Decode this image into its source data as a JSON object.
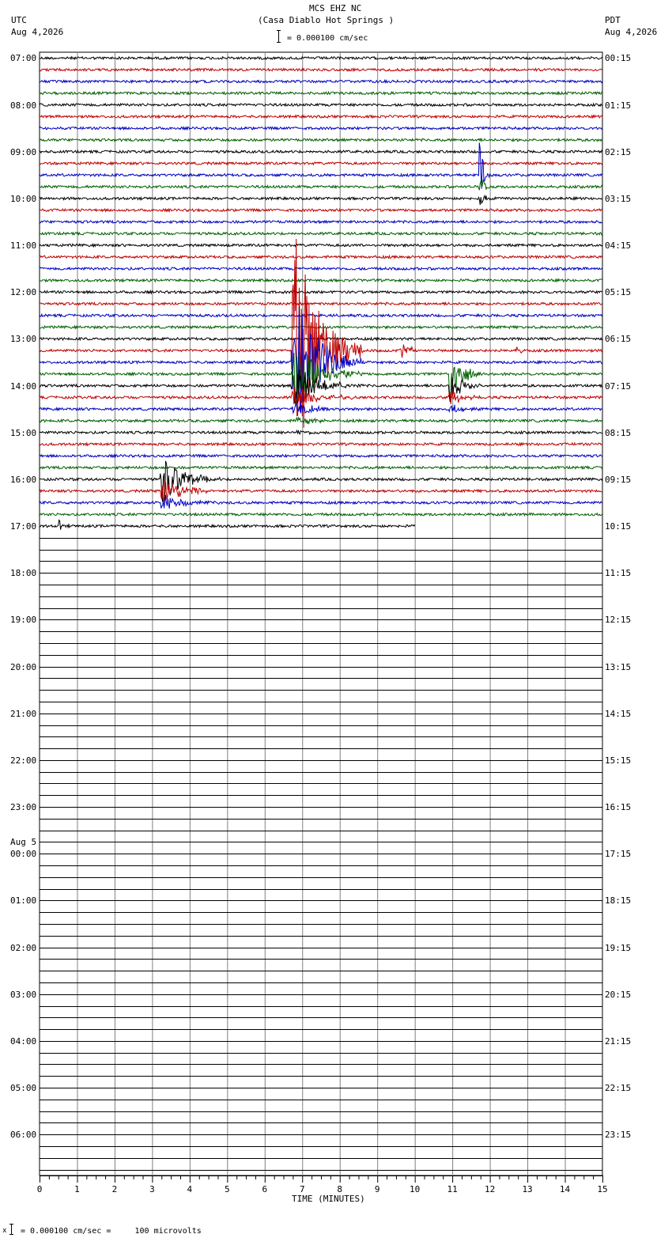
{
  "header": {
    "station": "MCS EHZ NC",
    "location": "(Casa Diablo Hot Springs )",
    "scale_text": "= 0.000100 cm/sec",
    "left_tz": "UTC",
    "left_date": "Aug 4,2026",
    "right_tz": "PDT",
    "right_date": "Aug 4,2026"
  },
  "footer": {
    "scale_text": "= 0.000100 cm/sec =     100 microvolts",
    "mark": "x"
  },
  "chart_data": {
    "type": "line",
    "title": "MCS EHZ NC",
    "subtitle": "(Casa Diablo Hot Springs )",
    "xlabel": "TIME (MINUTES)",
    "xlim": [
      0,
      15
    ],
    "x_ticks": [
      "0",
      "1",
      "2",
      "3",
      "4",
      "5",
      "6",
      "7",
      "8",
      "9",
      "10",
      "11",
      "12",
      "13",
      "14",
      "15"
    ],
    "rows_per_hour": 4,
    "total_rows": 96,
    "trace_colors": [
      "#000000",
      "#c00000",
      "#0000c0",
      "#006000"
    ],
    "grid": true,
    "left_labels": [
      {
        "row": 0,
        "text": "07:00"
      },
      {
        "row": 4,
        "text": "08:00"
      },
      {
        "row": 8,
        "text": "09:00"
      },
      {
        "row": 12,
        "text": "10:00"
      },
      {
        "row": 16,
        "text": "11:00"
      },
      {
        "row": 20,
        "text": "12:00"
      },
      {
        "row": 24,
        "text": "13:00"
      },
      {
        "row": 28,
        "text": "14:00"
      },
      {
        "row": 32,
        "text": "15:00"
      },
      {
        "row": 36,
        "text": "16:00"
      },
      {
        "row": 40,
        "text": "17:00"
      },
      {
        "row": 44,
        "text": "18:00"
      },
      {
        "row": 48,
        "text": "19:00"
      },
      {
        "row": 52,
        "text": "20:00"
      },
      {
        "row": 56,
        "text": "21:00"
      },
      {
        "row": 60,
        "text": "22:00"
      },
      {
        "row": 64,
        "text": "23:00"
      },
      {
        "row": 68,
        "text": "00:00"
      },
      {
        "row": 72,
        "text": "01:00"
      },
      {
        "row": 76,
        "text": "02:00"
      },
      {
        "row": 80,
        "text": "03:00"
      },
      {
        "row": 84,
        "text": "04:00"
      },
      {
        "row": 88,
        "text": "05:00"
      },
      {
        "row": 92,
        "text": "06:00"
      }
    ],
    "date_change_label": {
      "row": 68,
      "text": "Aug 5"
    },
    "right_labels": [
      {
        "row": 0,
        "text": "00:15"
      },
      {
        "row": 4,
        "text": "01:15"
      },
      {
        "row": 8,
        "text": "02:15"
      },
      {
        "row": 12,
        "text": "03:15"
      },
      {
        "row": 16,
        "text": "04:15"
      },
      {
        "row": 20,
        "text": "05:15"
      },
      {
        "row": 24,
        "text": "06:15"
      },
      {
        "row": 28,
        "text": "07:15"
      },
      {
        "row": 32,
        "text": "08:15"
      },
      {
        "row": 36,
        "text": "09:15"
      },
      {
        "row": 40,
        "text": "10:15"
      },
      {
        "row": 44,
        "text": "11:15"
      },
      {
        "row": 48,
        "text": "12:15"
      },
      {
        "row": 52,
        "text": "13:15"
      },
      {
        "row": 56,
        "text": "14:15"
      },
      {
        "row": 60,
        "text": "15:15"
      },
      {
        "row": 64,
        "text": "16:15"
      },
      {
        "row": 68,
        "text": "17:15"
      },
      {
        "row": 72,
        "text": "18:15"
      },
      {
        "row": 76,
        "text": "19:15"
      },
      {
        "row": 80,
        "text": "20:15"
      },
      {
        "row": 84,
        "text": "21:15"
      },
      {
        "row": 88,
        "text": "22:15"
      },
      {
        "row": 92,
        "text": "23:15"
      }
    ],
    "recorded_rows": 41,
    "last_row_end_minute": 10,
    "events": [
      {
        "row": 10,
        "start": 11.7,
        "end": 12.0,
        "amp": 5.0,
        "rows_span": 3
      },
      {
        "row": 25,
        "start": 6.7,
        "end": 8.6,
        "amp": 14.0,
        "rows_span": 8
      },
      {
        "row": 25,
        "start": 9.6,
        "end": 10.2,
        "amp": 1.2,
        "rows_span": 1
      },
      {
        "row": 25,
        "start": 12.7,
        "end": 12.9,
        "amp": 1.0,
        "rows_span": 1
      },
      {
        "row": 27,
        "start": 10.9,
        "end": 11.8,
        "amp": 3.5,
        "rows_span": 4
      },
      {
        "row": 36,
        "start": 3.2,
        "end": 4.8,
        "amp": 3.0,
        "rows_span": 3
      },
      {
        "row": 40,
        "start": 0.5,
        "end": 0.8,
        "amp": 0.8,
        "rows_span": 1
      }
    ]
  }
}
